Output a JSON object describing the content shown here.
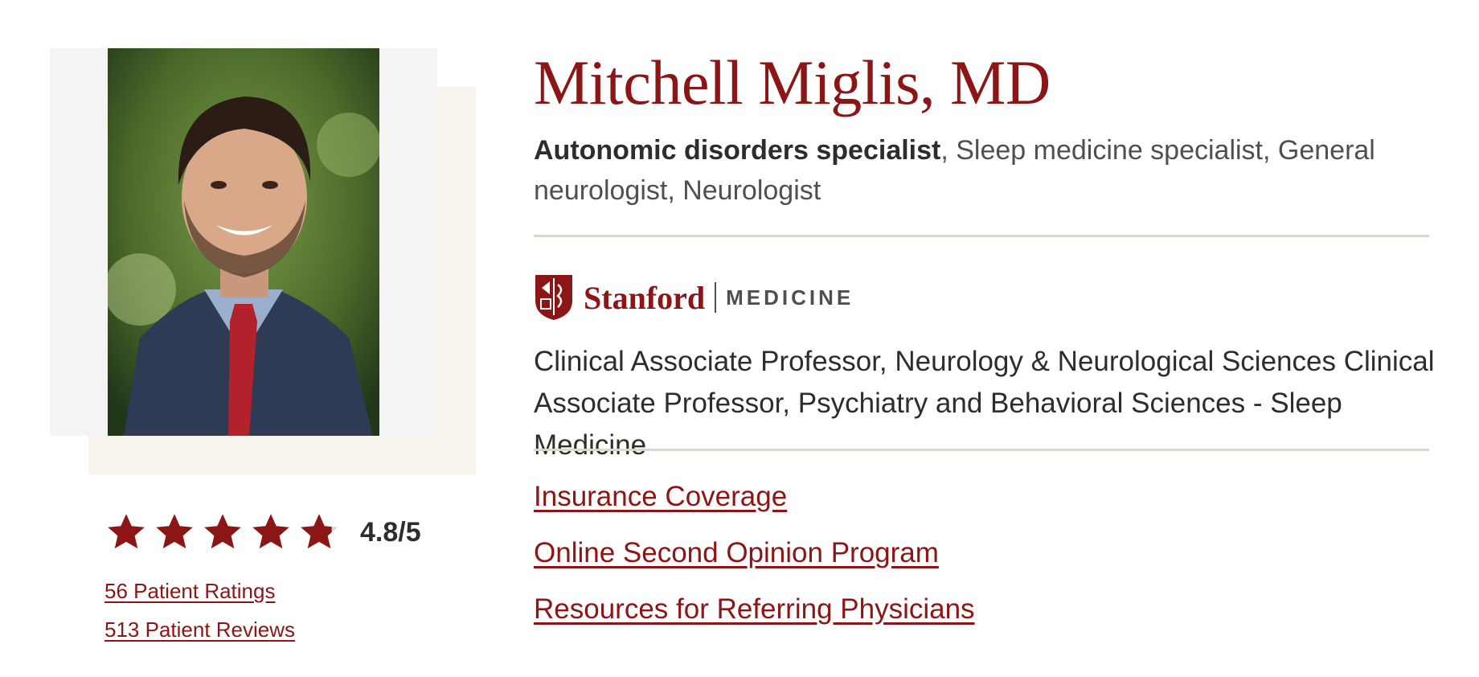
{
  "colors": {
    "accent": "#8c1515",
    "text": "#2e2d29",
    "muted": "#4d4f53",
    "divider": "#dad7cb"
  },
  "profile": {
    "name": "Mitchell Miglis, MD",
    "primary_specialty": "Autonomic disorders specialist",
    "other_specialties": ", Sleep medicine specialist, General neurologist, Neurologist",
    "photo_icon": "doctor-portrait"
  },
  "rating": {
    "score_value": 4.8,
    "score_max": 5,
    "score_text": "4.8/5",
    "stars_filled": 4.8,
    "ratings_link": "56 Patient Ratings",
    "reviews_link": "513 Patient Reviews"
  },
  "affiliation": {
    "logo_icon": "stanford-shield-icon",
    "wordmark": "Stanford",
    "sub": "MEDICINE",
    "titles": "Clinical Associate Professor, Neurology & Neurological Sciences Clinical Associate Professor, Psychiatry and Behavioral Sciences - Sleep Medicine"
  },
  "links": [
    {
      "label": "Insurance Coverage"
    },
    {
      "label": "Online Second Opinion Program"
    },
    {
      "label": "Resources for Referring Physicians"
    }
  ]
}
